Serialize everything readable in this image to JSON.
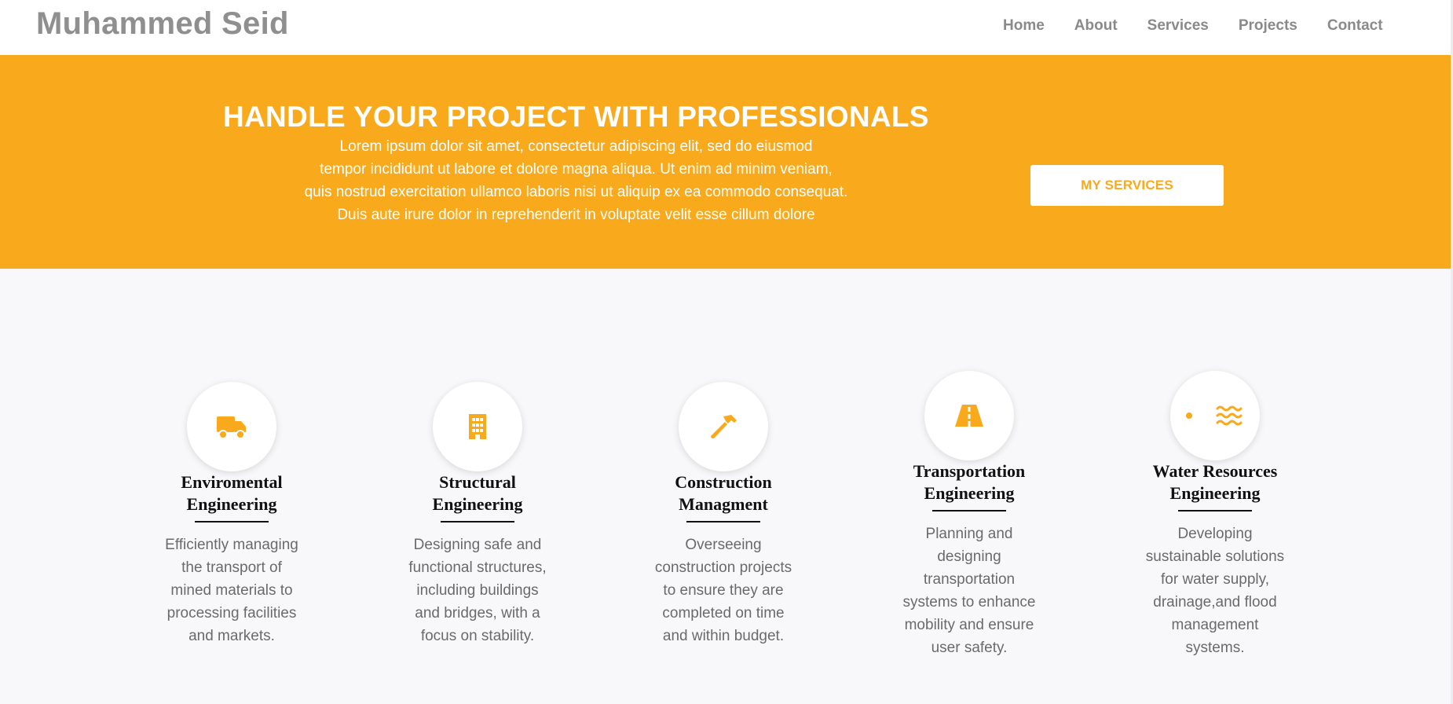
{
  "site": {
    "brand": "Muhammed Seid"
  },
  "nav": {
    "items": [
      "Home",
      "About",
      "Services",
      "Projects",
      "Contact"
    ]
  },
  "hero": {
    "title": "HANDLE YOUR PROJECT WITH PROFESSIONALS",
    "lines": [
      "Lorem ipsum dolor sit amet, consectetur adipiscing elit, sed do eiusmod",
      "tempor incididunt ut labore et dolore magna aliqua. Ut enim ad minim veniam,",
      "quis nostrud exercitation ullamco laboris nisi ut aliquip ex ea commodo consequat.",
      "Duis aute irure dolor in reprehenderit in voluptate velit esse cillum dolore"
    ],
    "button_label": "MY SERVICES"
  },
  "colors": {
    "accent": "#f9a91c",
    "nav_text": "#8a8a8a",
    "desc_text": "#6a6a6a",
    "section_bg": "#f8f8fa"
  },
  "services": [
    {
      "icon": "truck-icon",
      "title_lines": [
        "Enviromental",
        "Engineering"
      ],
      "desc_lines": [
        "Efficiently managing",
        "the transport of",
        "mined materials to",
        "processing facilities",
        "and markets."
      ]
    },
    {
      "icon": "building-icon",
      "title_lines": [
        "Structural",
        "Engineering"
      ],
      "desc_lines": [
        "Designing safe and",
        "functional structures,",
        "including buildings",
        "and bridges, with a",
        "focus on stability."
      ]
    },
    {
      "icon": "hammer-icon",
      "title_lines": [
        "Construction",
        "Managment"
      ],
      "desc_lines": [
        "Overseeing",
        "construction projects",
        "to ensure they are",
        "completed on time",
        "and within budget."
      ]
    },
    {
      "icon": "road-icon",
      "title_lines": [
        "Transportation",
        "Engineering"
      ],
      "desc_lines": [
        "Planning and",
        "designing",
        "transportation",
        "systems to enhance",
        "mobility and ensure",
        "user safety."
      ]
    },
    {
      "icon": "water-icon",
      "title_lines": [
        "Water Resources",
        "Engineering"
      ],
      "desc_lines": [
        "Developing",
        "sustainable solutions",
        "for water supply,",
        "drainage,and flood",
        "management",
        "systems."
      ]
    }
  ]
}
